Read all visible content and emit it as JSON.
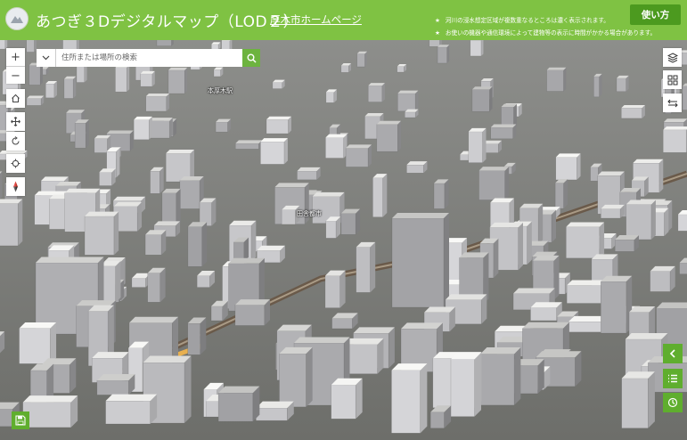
{
  "header": {
    "title": "あつぎ３Dデジタルマップ（LOD２）",
    "home_link": "厚木市ホームページ",
    "notes": [
      "河川の浸水想定区域が複数重なるところは濃く表示されます。",
      "お使いの機器や通信環境によって建物等の表示に時間がかかる場合があります。"
    ],
    "note_marker": "★",
    "help_label": "使い方"
  },
  "search": {
    "placeholder": "住所または場所の検索"
  },
  "map": {
    "labels": [
      "本厚木駅",
      "田舎都市"
    ]
  },
  "left_toolbar": {
    "zoom_in": "+",
    "zoom_out": "−",
    "icons": [
      "home-icon",
      "pan-icon",
      "rotate-icon",
      "locate-icon",
      "compass-icon"
    ]
  },
  "right_toolbar": {
    "icons": [
      "layers-icon",
      "basemap-icon",
      "swipe-icon",
      "collapse-chevron-icon",
      "list-icon",
      "time-icon"
    ]
  },
  "colors": {
    "header": "#7fc243",
    "button_green": "#5fae2e",
    "help_button": "#4c9a1f"
  }
}
